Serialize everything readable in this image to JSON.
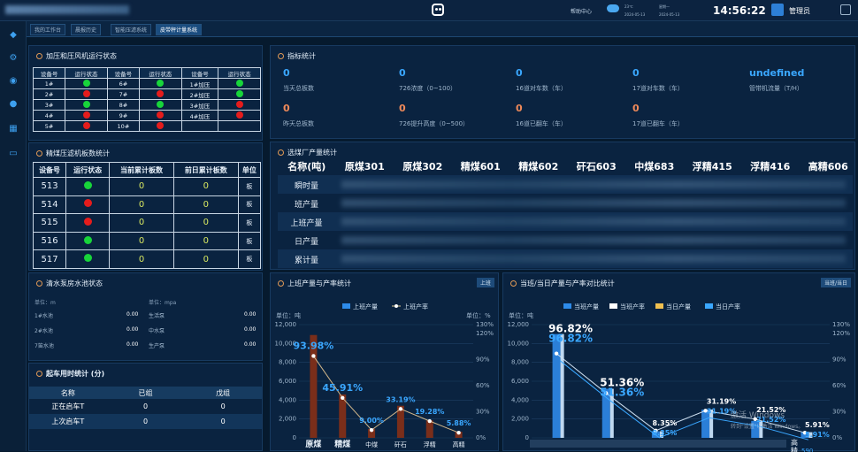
{
  "header": {
    "weather_temp": "23℃",
    "weather_date": "2024-05-13",
    "weekday": "星期一",
    "help": "帮助中心",
    "time": "14:56:22",
    "user": "管理员"
  },
  "tabs": [
    "我的工作台",
    "晨报历史",
    "智能压滤系统",
    "皮带秤计量系统"
  ],
  "press": {
    "title": "加压和压风机运行状态",
    "headers": [
      "设备号",
      "运行状态",
      "设备号",
      "运行状态",
      "设备号",
      "运行状态"
    ],
    "rows": [
      [
        "1#",
        "g",
        "6#",
        "g",
        "1#加压",
        "g"
      ],
      [
        "2#",
        "r",
        "7#",
        "r",
        "2#加压",
        "g"
      ],
      [
        "3#",
        "g",
        "8#",
        "g",
        "3#加压",
        "r"
      ],
      [
        "4#",
        "r",
        "9#",
        "r",
        "4#加压",
        "r"
      ],
      [
        "5#",
        "r",
        "10#",
        "r",
        "",
        ""
      ]
    ]
  },
  "filter": {
    "title": "精煤压滤机板数统计",
    "headers": [
      "设备号",
      "运行状态",
      "当前累计板数",
      "前日累计板数",
      "单位"
    ],
    "rows": [
      [
        "513",
        "g",
        "0",
        "0",
        "板"
      ],
      [
        "514",
        "r",
        "0",
        "0",
        "板"
      ],
      [
        "515",
        "r",
        "0",
        "0",
        "板"
      ],
      [
        "516",
        "g",
        "0",
        "0",
        "板"
      ],
      [
        "517",
        "g",
        "0",
        "0",
        "板"
      ]
    ]
  },
  "water": {
    "title": "清水泵房水池状态",
    "unit_left": "单位：m",
    "unit_right": "单位：mpa",
    "rows": [
      [
        "1#水池",
        "0.00",
        "生活泵",
        "0.00"
      ],
      [
        "2#水池",
        "0.00",
        "中水泵",
        "0.00"
      ],
      [
        "7笛水池",
        "0.00",
        "生产泵",
        "0.00"
      ]
    ]
  },
  "start": {
    "title": "起车用时统计 (分)",
    "headers": [
      "名称",
      "已组",
      "戊组"
    ],
    "rows": [
      [
        "正在启车T",
        "0",
        "0"
      ],
      [
        "上次启车T",
        "0",
        "0"
      ]
    ]
  },
  "index": {
    "title": "指标统计",
    "items": [
      {
        "v": "0",
        "l": "当天总板数",
        "c": "#3aa7ff"
      },
      {
        "v": "0",
        "l": "726浓度（0~100）",
        "c": "#3aa7ff"
      },
      {
        "v": "0",
        "l": "16道对车数（车）",
        "c": "#3aa7ff"
      },
      {
        "v": "0",
        "l": "17道对车数（车）",
        "c": "#3aa7ff"
      },
      {
        "v": "undefined",
        "l": "管带机流量（T/H）",
        "c": "#3aa7ff"
      },
      {
        "v": "0",
        "l": "昨天总板数",
        "c": "#f08a5a"
      },
      {
        "v": "0",
        "l": "726提升高度（0~500）",
        "c": "#f08a5a"
      },
      {
        "v": "0",
        "l": "16道已翻车（车）",
        "c": "#f08a5a"
      },
      {
        "v": "0",
        "l": "17道已翻车（车）",
        "c": "#f08a5a"
      }
    ]
  },
  "prod": {
    "title": "选煤厂产量统计",
    "headers": [
      "名称(吨)",
      "原煤301",
      "原煤302",
      "精煤601",
      "精煤602",
      "矸石603",
      "中煤683",
      "浮精415",
      "浮精416",
      "高精606"
    ],
    "rows": [
      "瞬时量",
      "班产量",
      "上班产量",
      "日产量",
      "累计量"
    ]
  },
  "chart1": {
    "title": "上班产量与产率统计",
    "badge": "上班"
  },
  "chart2": {
    "title": "当班/当日产量与产率对比统计",
    "badge": "当班/当日"
  },
  "chart_data": [
    {
      "type": "bar",
      "categories": [
        "原煤",
        "精煤",
        "中煤",
        "矸石",
        "浮精",
        "高精"
      ],
      "series": [
        {
          "name": "上班产量",
          "values": [
            10900,
            4600,
            950,
            3400,
            1850,
            650
          ]
        },
        {
          "name": "上班产率",
          "values": [
            93.98,
            45.91,
            9.0,
            33.19,
            19.28,
            5.88
          ]
        }
      ],
      "ylabel": "单位：吨",
      "y2label": "单位：%",
      "ylim": [
        0,
        12000
      ],
      "y2lim": [
        0,
        130
      ],
      "yticks": [
        "0",
        "2,000",
        "4,000",
        "6,000",
        "8,000",
        "10,000",
        "12,000"
      ],
      "y2ticks": [
        "0%",
        "30%",
        "60%",
        "90%",
        "120%",
        "130%"
      ],
      "labels": [
        "93.98%",
        "45.91%",
        "9.00%",
        "33.19%",
        "19.28%",
        "5.88%"
      ]
    },
    {
      "type": "bar",
      "categories": [
        "原煤",
        "精煤",
        "中煤",
        "矸石",
        "浮精",
        "高精"
      ],
      "series": [
        {
          "name": "当班产量",
          "values": [
            11000,
            5200,
            700,
            3000,
            1800,
            600
          ]
        },
        {
          "name": "当班产率",
          "values": [
            96.82,
            51.36,
            8.35,
            31.19,
            21.52,
            5.91
          ]
        },
        {
          "name": "当日产量",
          "values": [
            11000,
            5200,
            700,
            3000,
            1800,
            600
          ]
        },
        {
          "name": "当日产率",
          "values": [
            96.82,
            51.36,
            8.35,
            31.19,
            21.52,
            5.91
          ]
        }
      ],
      "ylabel": "单位：吨",
      "ylim": [
        0,
        12000
      ],
      "y2lim": [
        0,
        130
      ],
      "yticks": [
        "0",
        "2,000",
        "4,000",
        "6,000",
        "8,000",
        "10,000",
        "12,000"
      ],
      "y2ticks": [
        "0%",
        "30%",
        "60%",
        "90%",
        "120%",
        "130%"
      ],
      "labels": [
        "96.82%",
        "51.36%",
        "8.35%",
        "31.19%",
        "21.52%",
        "5.91%"
      ],
      "xtail": [
        "高",
        "精",
        "590"
      ]
    }
  ],
  "watermark": {
    "line1": "激活 Windows",
    "line2": "转到\"设置\"以激活 Windows。"
  }
}
